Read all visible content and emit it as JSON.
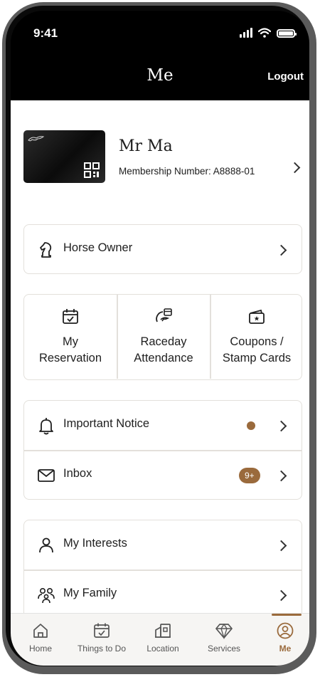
{
  "status_bar": {
    "time": "9:41"
  },
  "header": {
    "title": "Me",
    "logout_label": "Logout"
  },
  "profile": {
    "name": "Mr Ma",
    "membership": "Membership Number: A8888-01"
  },
  "horse_owner": {
    "label": "Horse Owner"
  },
  "quick_actions": [
    {
      "label": "My\nReservation",
      "icon": "calendar-check-icon"
    },
    {
      "label": "Raceday\nAttendance",
      "icon": "raceday-gauge-icon"
    },
    {
      "label": "Coupons /\nStamp Cards",
      "icon": "coupon-wallet-icon"
    }
  ],
  "notifications": [
    {
      "label": "Important Notice",
      "icon": "bell-icon"
    },
    {
      "label": "Inbox",
      "icon": "envelope-icon",
      "badge": "9+"
    }
  ],
  "personal": [
    {
      "label": "My Interests",
      "icon": "person-icon"
    },
    {
      "label": "My Family",
      "icon": "family-icon"
    }
  ],
  "tabs": [
    {
      "label": "Home",
      "icon": "home-icon"
    },
    {
      "label": "Things to Do",
      "icon": "calendar-icon"
    },
    {
      "label": "Location",
      "icon": "location-building-icon"
    },
    {
      "label": "Services",
      "icon": "diamond-icon"
    },
    {
      "label": "Me",
      "icon": "user-circle-icon",
      "active": true
    }
  ],
  "colors": {
    "accent": "#9a6a3c",
    "header_bg": "#000000",
    "border": "#e3e0db"
  }
}
